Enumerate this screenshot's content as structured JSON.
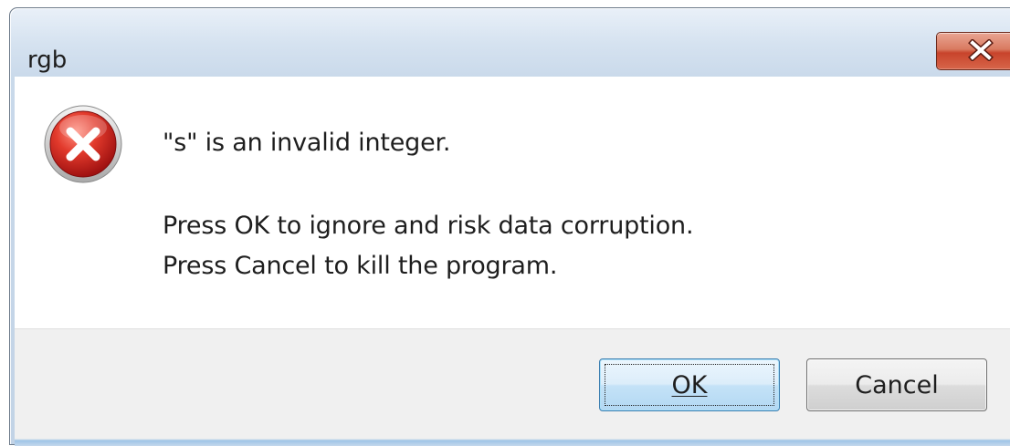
{
  "window": {
    "title": "rgb"
  },
  "message": {
    "line1": "\"s\" is an invalid integer.",
    "line2": "Press OK to ignore and risk data corruption.",
    "line3": "Press Cancel to kill the program."
  },
  "buttons": {
    "ok_label": "OK",
    "cancel_label": "Cancel"
  },
  "icons": {
    "error": "error-icon",
    "close": "close-icon"
  },
  "colors": {
    "close_button": "#c8432b",
    "error_icon_red": "#c62222",
    "footer_background": "#f0f0f0"
  }
}
